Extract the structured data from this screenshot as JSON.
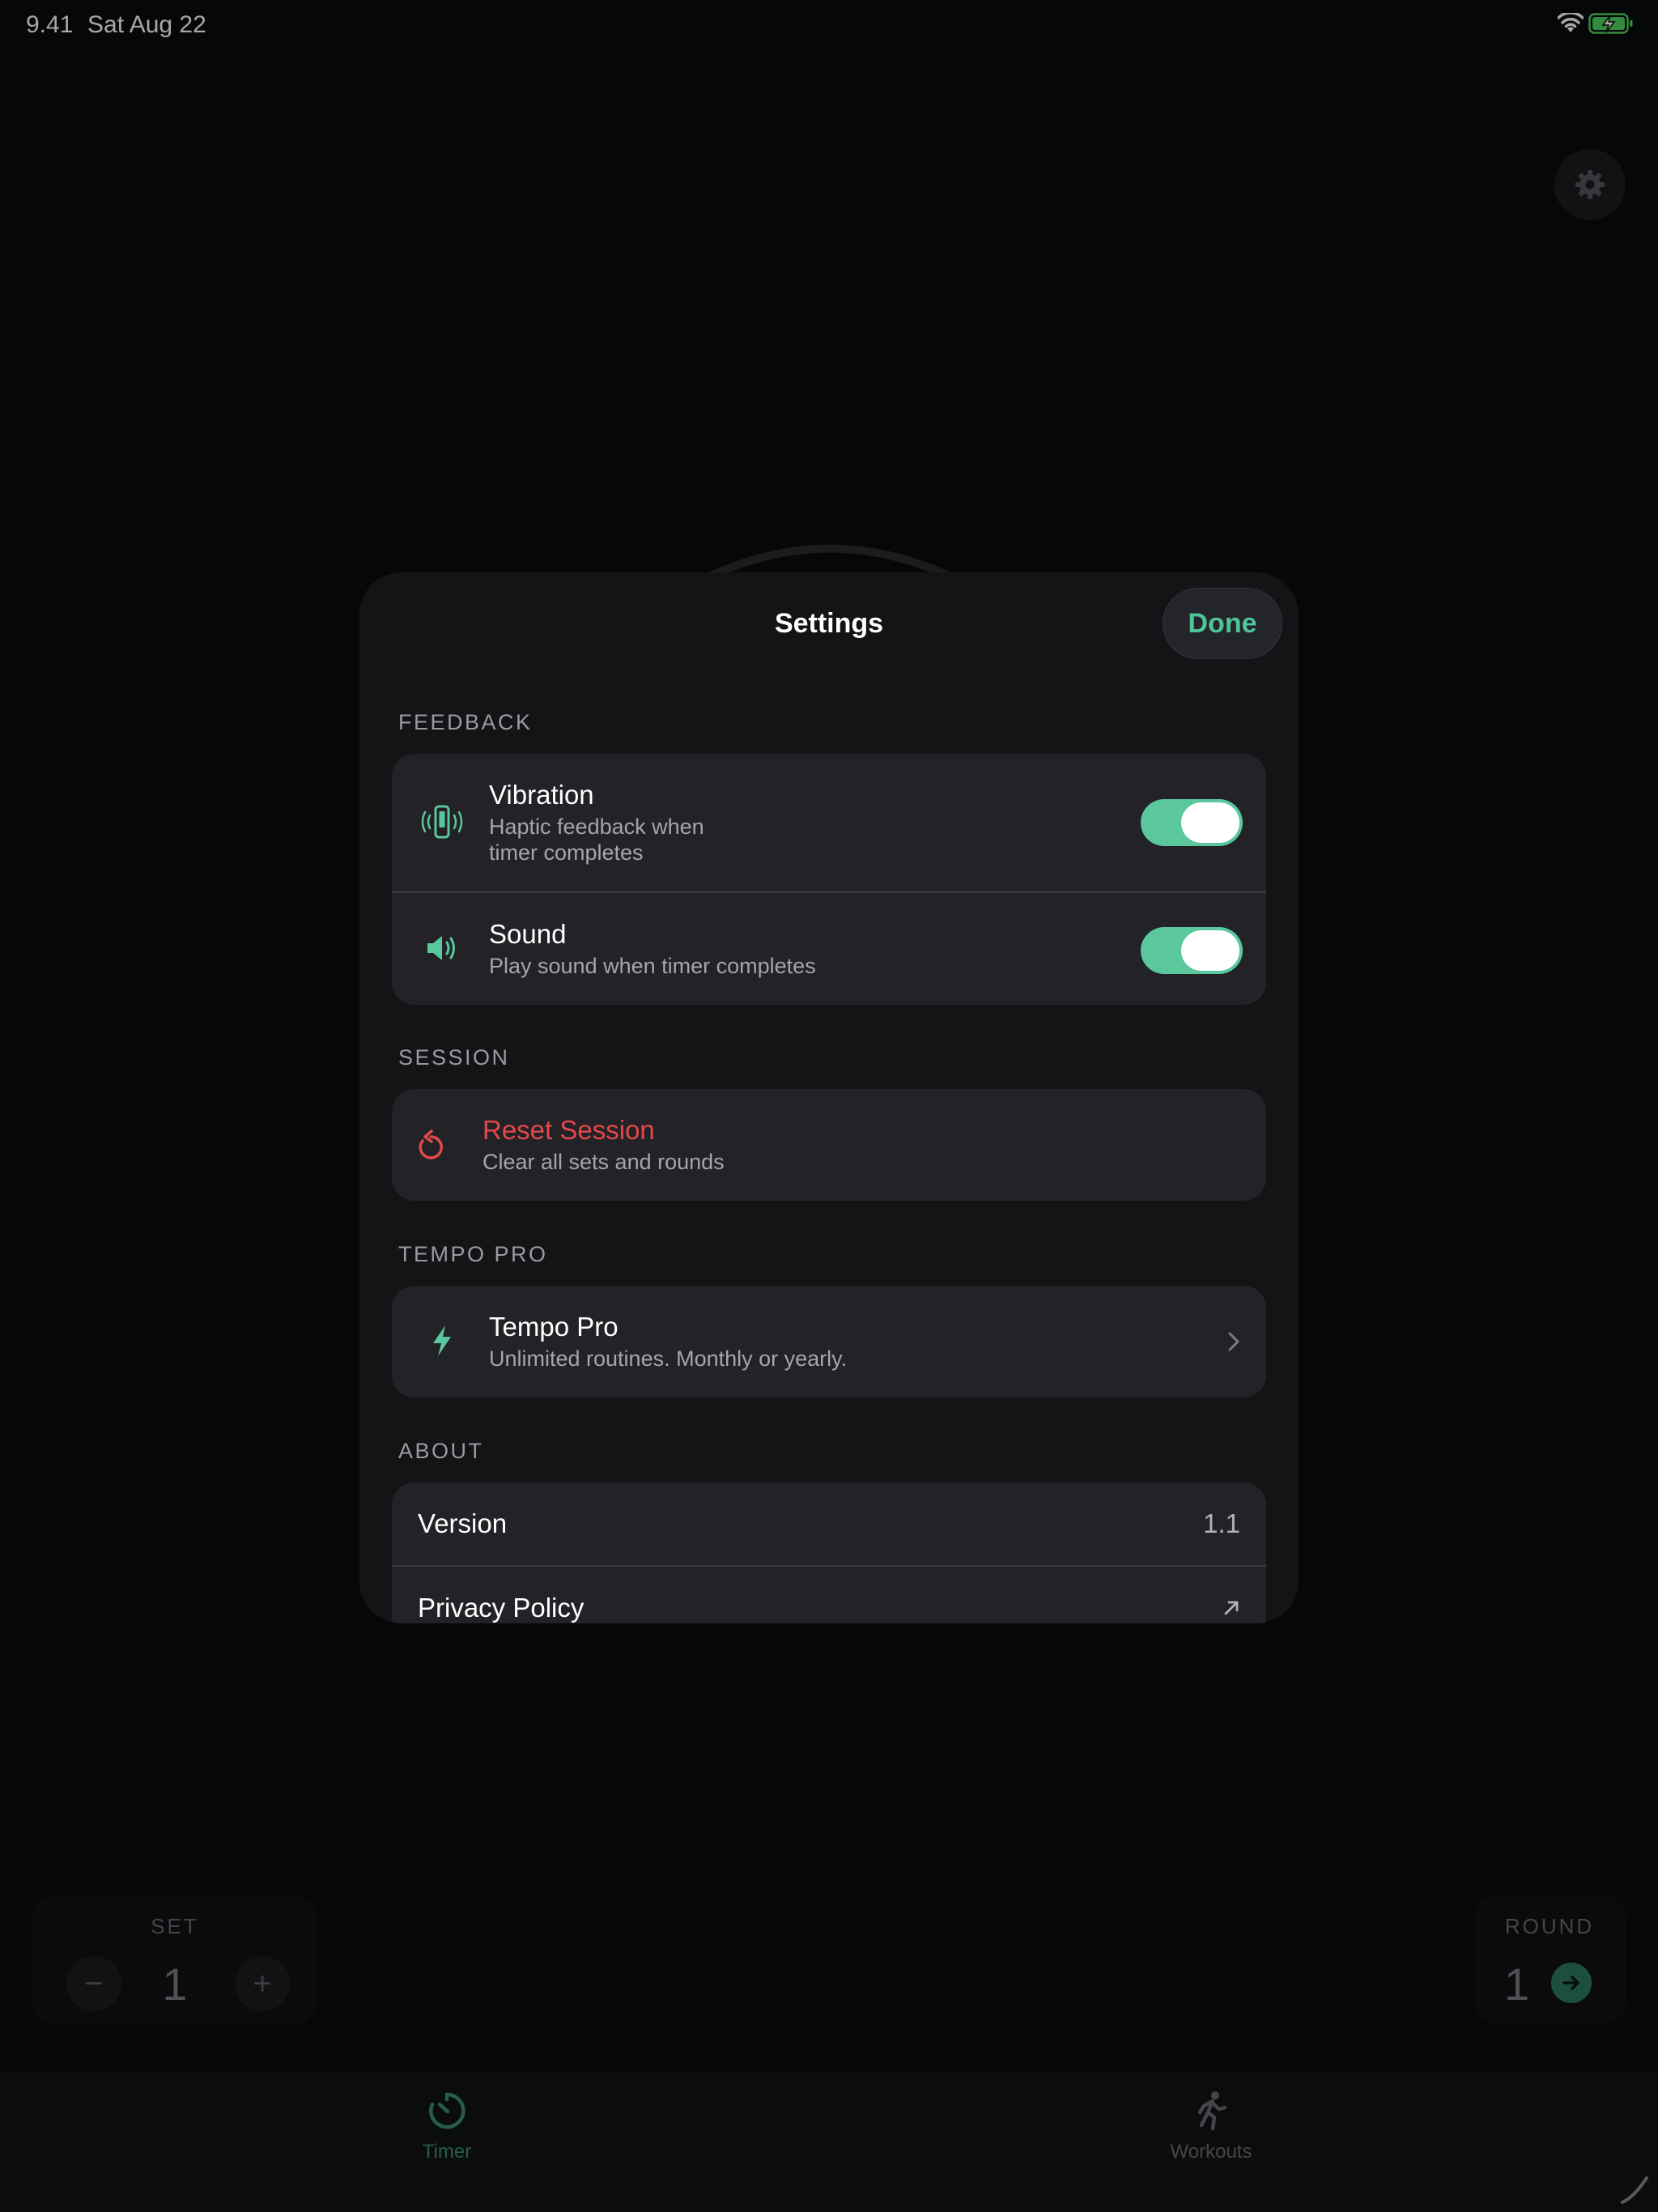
{
  "status_bar": {
    "time": "9.41",
    "date": "Sat Aug 22"
  },
  "counters": {
    "set": {
      "label": "SET",
      "value": "1",
      "minus": "−",
      "plus": "+"
    },
    "round": {
      "label": "ROUND",
      "value": "1"
    }
  },
  "tabs": [
    {
      "label": "Timer",
      "icon": "timer-icon",
      "active": true
    },
    {
      "label": "Workouts",
      "icon": "running-figure-icon",
      "active": false
    }
  ],
  "settings": {
    "title": "Settings",
    "done_label": "Done",
    "sections": {
      "feedback": {
        "label": "FEEDBACK",
        "vibration": {
          "title": "Vibration",
          "subtitle_line1": "Haptic feedback when",
          "subtitle_line2": "timer completes",
          "enabled": true,
          "icon": "vibration-phone-icon"
        },
        "sound": {
          "title": "Sound",
          "subtitle": "Play sound when timer completes",
          "enabled": true,
          "icon": "speaker-icon"
        }
      },
      "session": {
        "label": "SESSION",
        "reset": {
          "title": "Reset Session",
          "subtitle": "Clear all sets and rounds",
          "icon": "reset-arrow-icon"
        }
      },
      "pro": {
        "label": "TEMPO PRO",
        "item": {
          "title": "Tempo Pro",
          "subtitle": "Unlimited routines. Monthly or yearly.",
          "icon": "lightning-bolt-icon"
        }
      },
      "about": {
        "label": "ABOUT",
        "version_label": "Version",
        "version_value": "1.1",
        "privacy_label": "Privacy Policy"
      }
    }
  },
  "colors": {
    "accent": "#5ac79c",
    "destructive": "#e4484b",
    "background": "#0a0b0d",
    "sheet": "#141417",
    "group": "#222227"
  }
}
